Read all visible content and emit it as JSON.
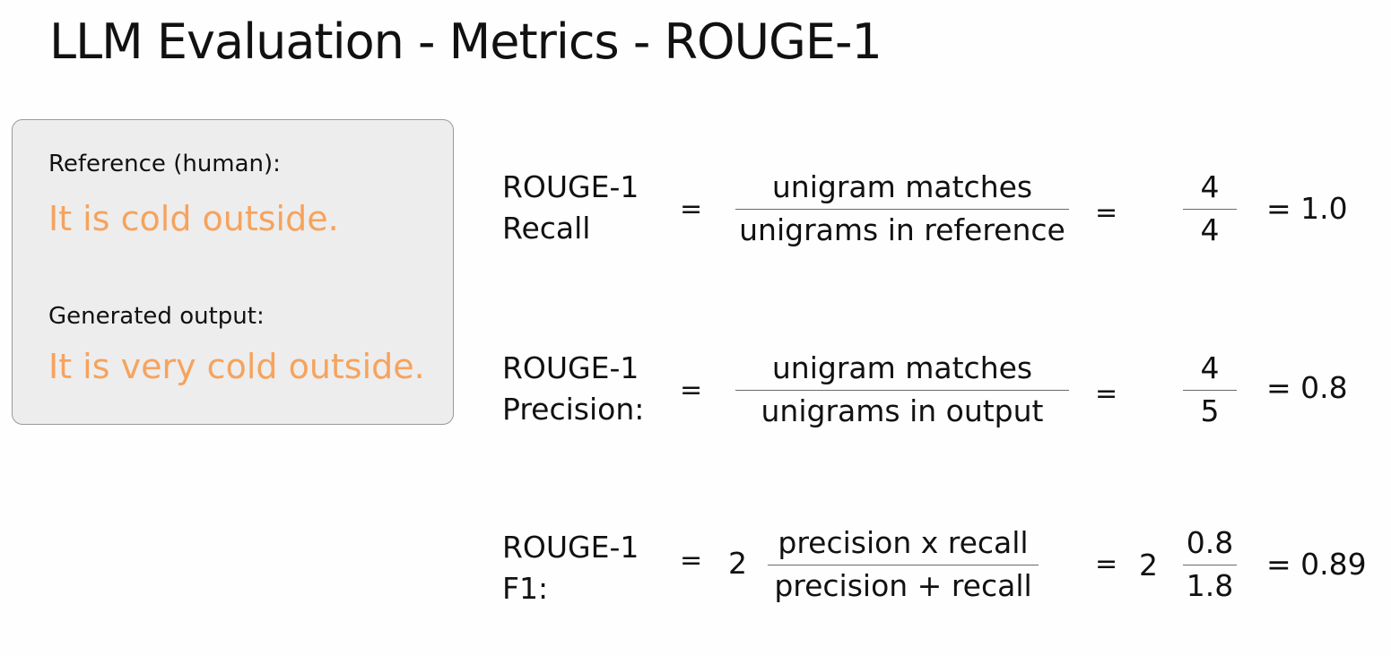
{
  "title": "LLM Evaluation - Metrics - ROUGE-1",
  "example": {
    "reference_label": "Reference (human):",
    "reference_text": "It is cold outside.",
    "generated_label": "Generated output:",
    "generated_text": "It is very cold outside."
  },
  "metrics": {
    "recall": {
      "name_line1": "ROUGE-1",
      "name_line2": "Recall",
      "eq1": "=",
      "numerator": "unigram matches",
      "denominator": "unigrams in reference",
      "eq2": "=",
      "value_num": "4",
      "value_den": "4",
      "result": "= 1.0"
    },
    "precision": {
      "name_line1": "ROUGE-1",
      "name_line2": "Precision:",
      "eq1": "=",
      "numerator": "unigram matches",
      "denominator": "unigrams in output",
      "eq2": "=",
      "value_num": "4",
      "value_den": "5",
      "result": "= 0.8"
    },
    "f1": {
      "name_line1": "ROUGE-1",
      "name_line2": "F1:",
      "eq1": "=",
      "coef1": "2",
      "numerator": "precision x recall",
      "denominator": "precision + recall",
      "eq2": "=",
      "coef2": "2",
      "value_num": "0.8",
      "value_den": "1.8",
      "result": "= 0.89"
    }
  },
  "colors": {
    "accent_orange": "#f6a35d",
    "box_background": "#ededed",
    "text": "#111111"
  }
}
